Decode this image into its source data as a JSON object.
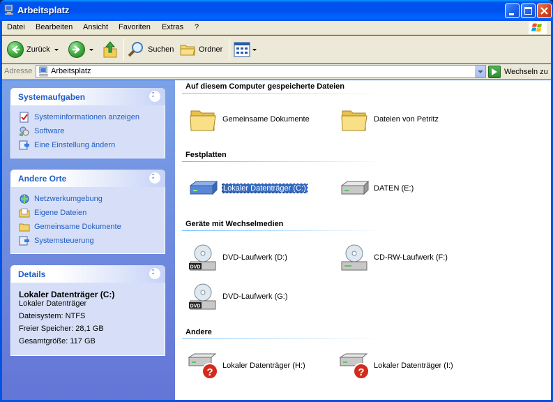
{
  "window": {
    "title": "Arbeitsplatz"
  },
  "menu": [
    "Datei",
    "Bearbeiten",
    "Ansicht",
    "Favoriten",
    "Extras",
    "?"
  ],
  "toolbar": {
    "back_label": "Zurück",
    "search_label": "Suchen",
    "folders_label": "Ordner"
  },
  "address": {
    "label": "Adresse",
    "value": "Arbeitsplatz",
    "go_label": "Wechseln zu"
  },
  "sidebar": {
    "system_tasks": {
      "title": "Systemaufgaben",
      "items": [
        "Systeminformationen anzeigen",
        "Software",
        "Eine Einstellung ändern"
      ]
    },
    "other_places": {
      "title": "Andere Orte",
      "items": [
        "Netzwerkumgebung",
        "Eigene Dateien",
        "Gemeinsame Dokumente",
        "Systemsteuerung"
      ]
    },
    "details": {
      "title": "Details",
      "name": "Lokaler Datenträger (C:)",
      "type": "Lokaler Datenträger",
      "filesystem": "Dateisystem: NTFS",
      "free": "Freier Speicher: 28,1 GB",
      "total": "Gesamtgröße: 117 GB"
    }
  },
  "content": {
    "groups": [
      {
        "title": "Auf diesem Computer gespeicherte Dateien",
        "items": [
          "Gemeinsame Dokumente",
          "Dateien von Petritz"
        ]
      },
      {
        "title": "Festplatten",
        "items": [
          "Lokaler Datenträger (C:)",
          "DATEN (E:)"
        ]
      },
      {
        "title": "Geräte mit Wechselmedien",
        "items": [
          "DVD-Laufwerk (D:)",
          "CD-RW-Laufwerk (F:)",
          "DVD-Laufwerk (G:)"
        ]
      },
      {
        "title": "Andere",
        "items": [
          "Lokaler Datenträger (H:)",
          "Lokaler Datenträger (I:)"
        ]
      }
    ],
    "selected_item": "Lokaler Datenträger (C:)"
  },
  "icons": {
    "dvd_badge": "DVD"
  },
  "colors": {
    "titlebar": "#0054e3",
    "taskpane": "#6d8ee0",
    "link": "#215dc6",
    "selection": "#316ac5"
  }
}
